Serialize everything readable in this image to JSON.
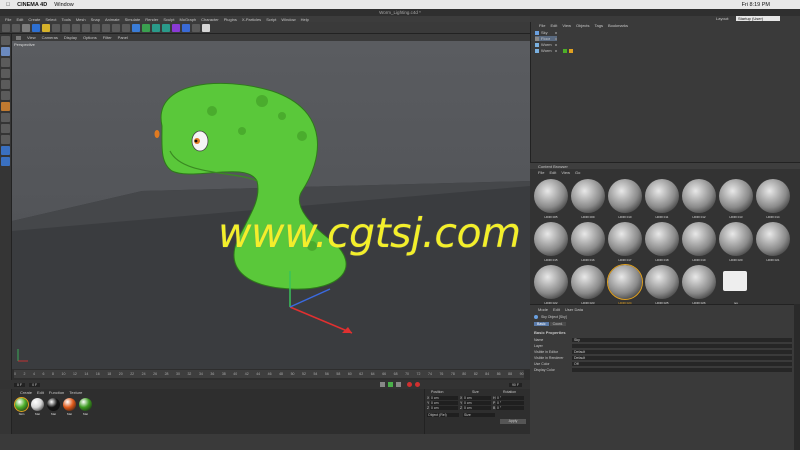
{
  "mac_menubar": {
    "apple": "",
    "app": "CINEMA 4D",
    "window": "Window",
    "clock": "Fri 8:19 PM"
  },
  "title": "Worm_Lighting.c4d *",
  "app_menu": [
    "File",
    "Edit",
    "Create",
    "Select",
    "Tools",
    "Mesh",
    "Snap",
    "Animate",
    "Simulate",
    "Render",
    "Sculpt",
    "MoGraph",
    "Character",
    "Plugins",
    "X-Particles",
    "Script",
    "Window",
    "Help"
  ],
  "layout": {
    "label": "Layout:",
    "value": "Startup (User)"
  },
  "viewport": {
    "menu": [
      "View",
      "Cameras",
      "Display",
      "Options",
      "Filter",
      "Panel"
    ],
    "camera_label": "Perspective"
  },
  "watermark": "www.cgtsj.com",
  "timeline": {
    "ticks": [
      "0",
      "2",
      "4",
      "6",
      "8",
      "10",
      "12",
      "14",
      "16",
      "18",
      "20",
      "22",
      "24",
      "26",
      "28",
      "30",
      "32",
      "34",
      "36",
      "38",
      "40",
      "42",
      "44",
      "46",
      "48",
      "50",
      "52",
      "54",
      "56",
      "58",
      "60",
      "62",
      "64",
      "66",
      "68",
      "70",
      "72",
      "74",
      "76",
      "78",
      "80",
      "82",
      "84",
      "86",
      "88",
      "90"
    ],
    "start": "0 F",
    "current": "0 F",
    "end": "90 F"
  },
  "materials": {
    "menu": [
      "Create",
      "Edit",
      "Function",
      "Texture"
    ],
    "items": [
      {
        "label": "Skin",
        "color": "#4caf28"
      },
      {
        "label": "Mat",
        "color": "#d8d8d8"
      },
      {
        "label": "Mat",
        "color": "#151515"
      },
      {
        "label": "Mat",
        "color": "#e05a1a"
      },
      {
        "label": "Mat",
        "color": "#3c9a20"
      }
    ]
  },
  "coords": {
    "headers": [
      "Position",
      "Size",
      "Rotation"
    ],
    "rows": [
      {
        "axis": "X",
        "pos": "0 cm",
        "saxis": "X",
        "size": "0 cm",
        "raxis": "H",
        "rot": "0 °"
      },
      {
        "axis": "Y",
        "pos": "0 cm",
        "saxis": "Y",
        "size": "0 cm",
        "raxis": "P",
        "rot": "0 °"
      },
      {
        "axis": "Z",
        "pos": "0 cm",
        "saxis": "Z",
        "size": "0 cm",
        "raxis": "B",
        "rot": "0 °"
      }
    ],
    "mode": "Object (Rel)",
    "size_mode": "Size",
    "apply": "Apply"
  },
  "object_manager": {
    "menu": [
      "File",
      "Edit",
      "View",
      "Objects",
      "Tags",
      "Bookmarks"
    ],
    "items": [
      "Sky",
      "Floor",
      "Worm",
      "Worm"
    ]
  },
  "content_browser": {
    "title": "Content Browser",
    "menu": [
      "File",
      "Edit",
      "View",
      "Go"
    ],
    "items": [
      "HDRI 005",
      "HDRI 009",
      "HDRI 010",
      "HDRI 011",
      "HDRI 012",
      "HDRI 013",
      "HDRI 014",
      "HDRI 015",
      "HDRI 016",
      "HDRI 017",
      "HDRI 018",
      "HDRI 019",
      "HDRI 020",
      "HDRI 021",
      "HDRI 022",
      "HDRI 023",
      "HDRI 024",
      "HDRI 025",
      "HDRI 026",
      "tex"
    ],
    "selected": "HDRI 024"
  },
  "attributes": {
    "menu": [
      "Mode",
      "Edit",
      "User Data"
    ],
    "object_label": "Sky Object [Sky]",
    "tabs": [
      "Basic",
      "Coord."
    ],
    "section": "Basic Properties",
    "fields": [
      {
        "label": "Name",
        "value": "Sky"
      },
      {
        "label": "Layer",
        "value": ""
      },
      {
        "label": "Visible in Editor",
        "value": "Default"
      },
      {
        "label": "Visible in Renderer",
        "value": "Default"
      },
      {
        "label": "Use Color",
        "value": "Off"
      },
      {
        "label": "Display Color",
        "value": ""
      }
    ]
  }
}
